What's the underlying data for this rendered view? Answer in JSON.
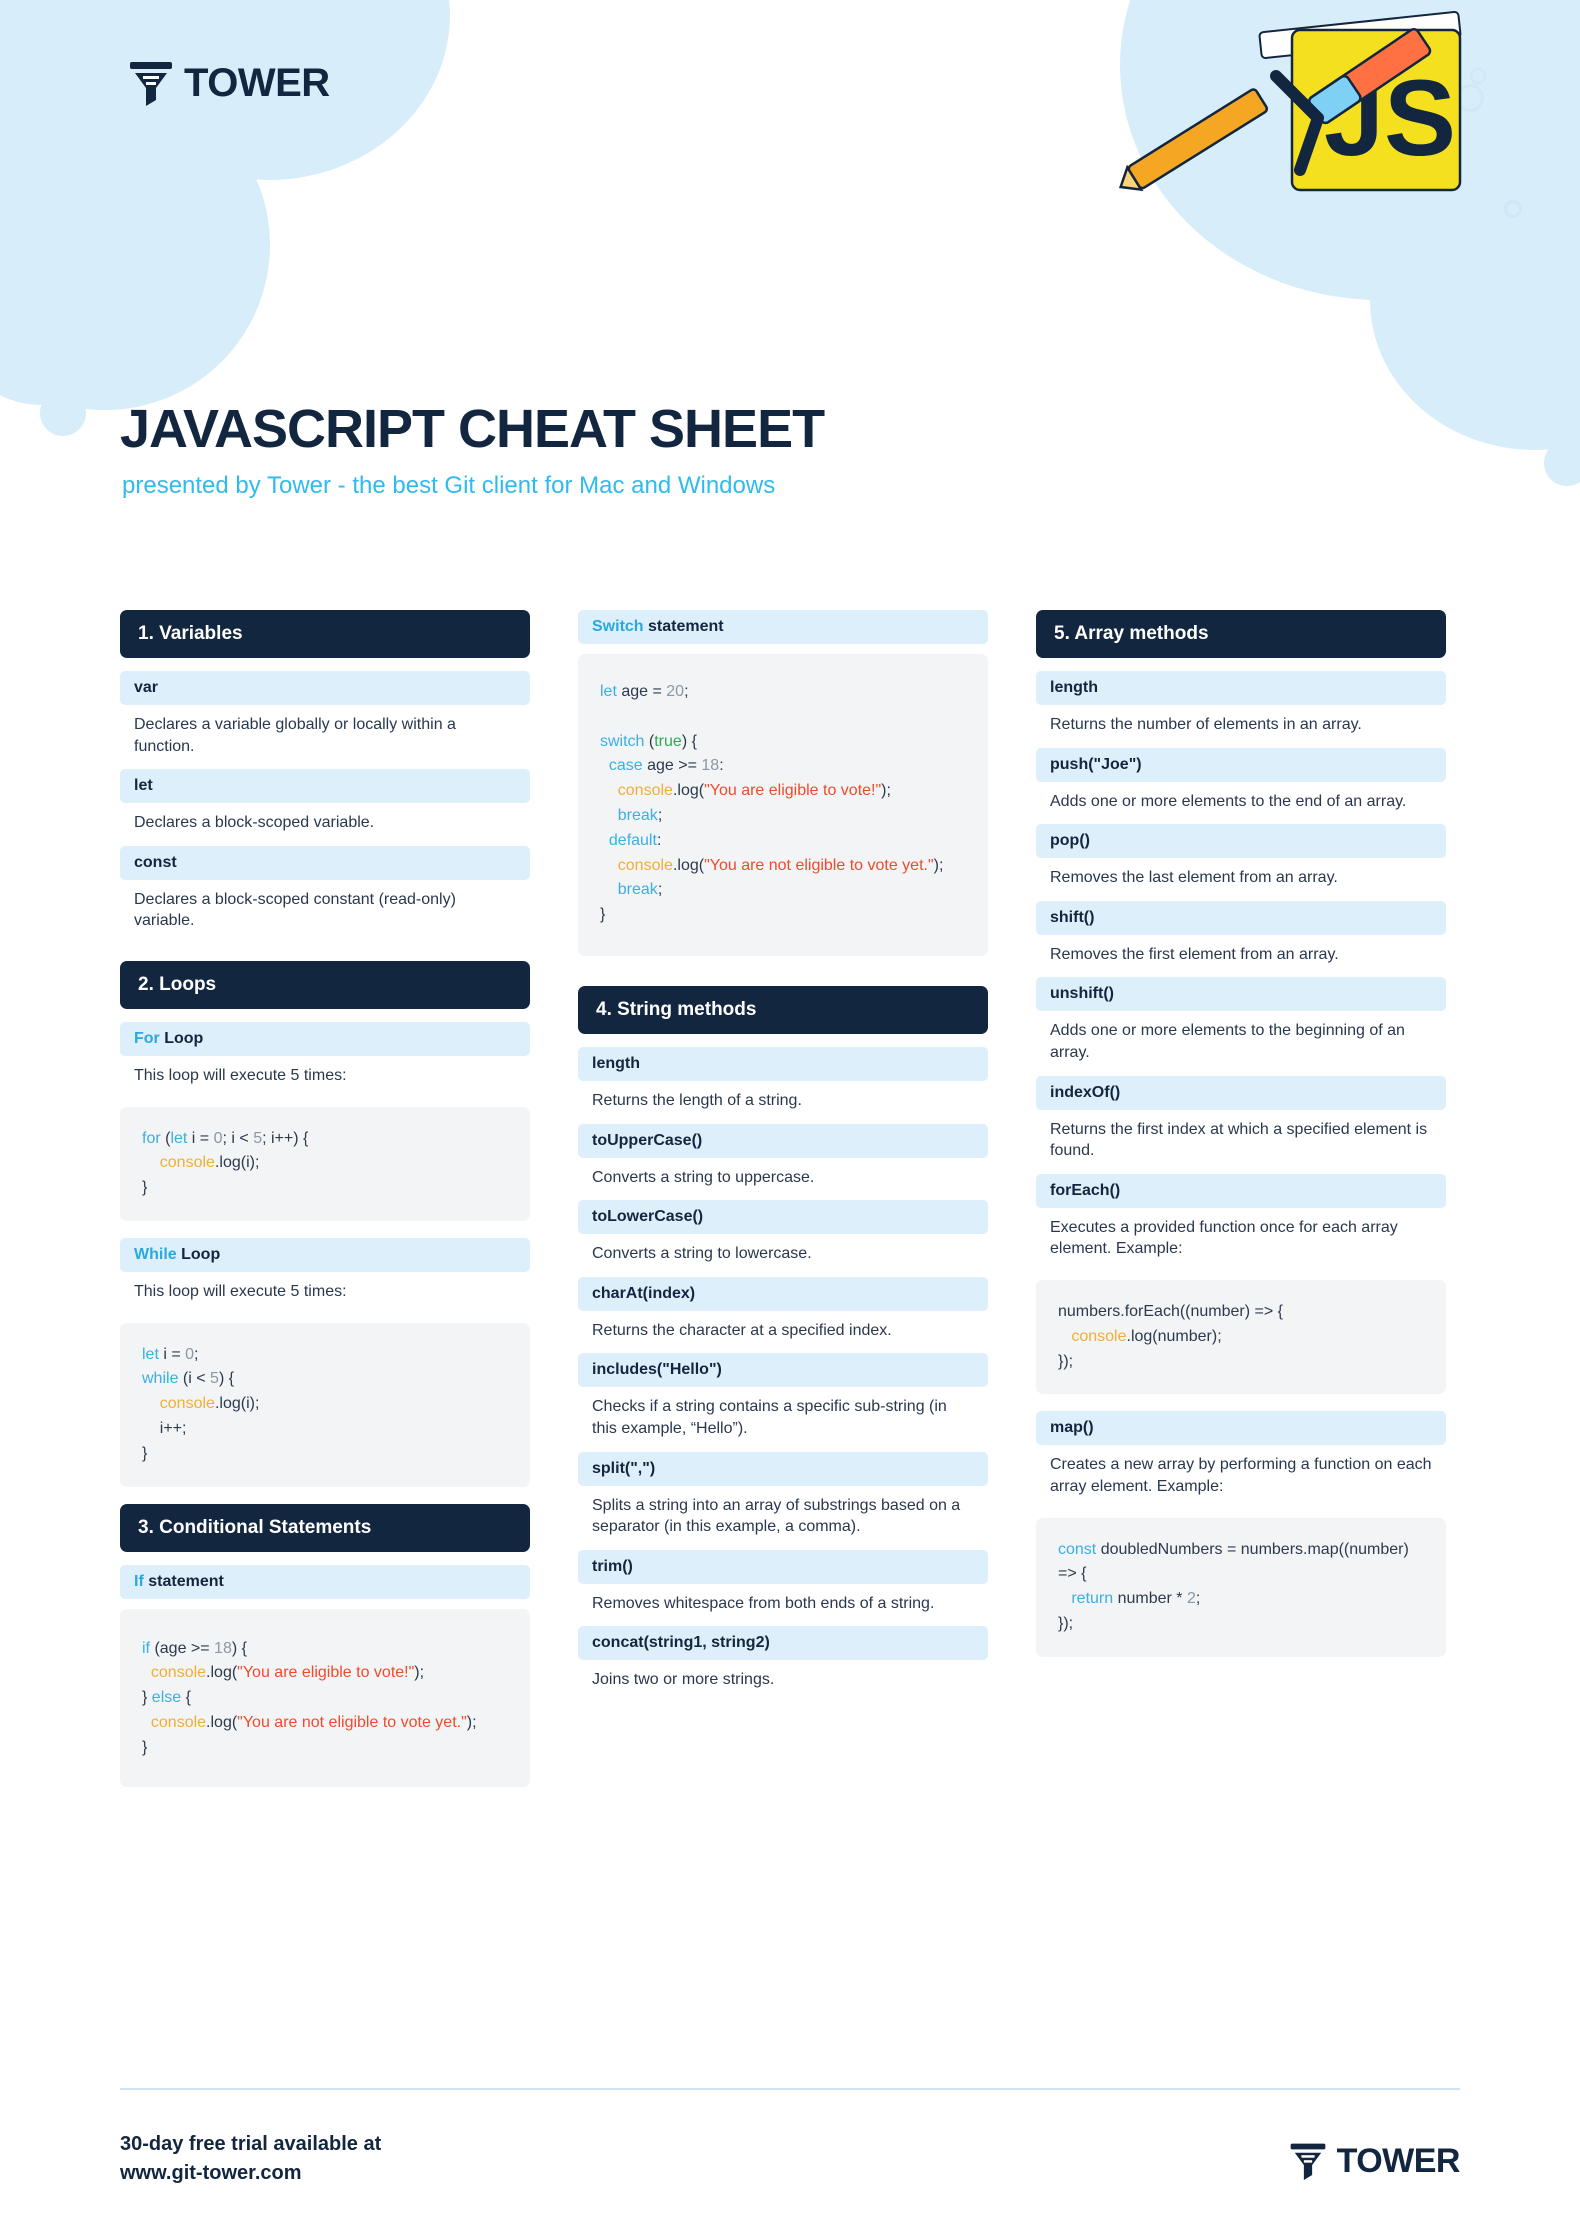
{
  "brand": {
    "name": "TOWER",
    "logo_icon": "tower-funnel-logo-icon"
  },
  "hero": {
    "title": "JAVASCRIPT CHEAT SHEET",
    "subtitle": "presented by Tower - the best Git client for Mac and Windows",
    "art_label": "JS",
    "art_icon": "javascript-sticker-illustration"
  },
  "colors": {
    "dark": "#13263f",
    "accent": "#2fbbee",
    "subhead_bg": "#ddeffa",
    "code_bg": "#f3f4f6",
    "keyword": "#3aafe3",
    "number": "#8a98a6",
    "function": "#f2ae34",
    "string": "#ef4b2b",
    "boolean": "#2faa54"
  },
  "columns": [
    {
      "sections": [
        {
          "heading": "1. Variables",
          "items": [
            {
              "term": "var",
              "desc": "Declares a variable globally or locally within a function."
            },
            {
              "term": "let",
              "desc": "Declares a block-scoped variable."
            },
            {
              "term": "const",
              "desc": "Declares a block-scoped constant (read-only) variable."
            }
          ]
        },
        {
          "heading": "2. Loops",
          "items": [
            {
              "term_kw": "For",
              "term_rest": "Loop",
              "desc": "This loop will execute 5 times:",
              "code_id": "for-loop"
            },
            {
              "term_kw": "While",
              "term_rest": "Loop",
              "desc": "This loop will execute 5 times:",
              "code_id": "while-loop"
            }
          ]
        },
        {
          "heading": "3. Conditional Statements",
          "items": [
            {
              "term_kw": "If",
              "term_rest": "statement",
              "code_id": "if-statement"
            }
          ]
        }
      ]
    },
    {
      "sections": [
        {
          "heading": null,
          "items": [
            {
              "term_kw": "Switch",
              "term_rest": "statement",
              "code_id": "switch-statement"
            }
          ]
        },
        {
          "heading": "4. String methods",
          "items": [
            {
              "term": "length",
              "desc": "Returns the length of a string."
            },
            {
              "term": "toUpperCase()",
              "desc": "Converts a string to uppercase."
            },
            {
              "term": "toLowerCase()",
              "desc": "Converts a string to lowercase."
            },
            {
              "term": "charAt(index)",
              "desc": "Returns the character at a specified index."
            },
            {
              "term": "includes(\"Hello\")",
              "desc": "Checks if a string contains a specific sub-string (in this example, “Hello”)."
            },
            {
              "term": "split(\",\")",
              "desc": "Splits a string into an array of substrings based on a separator (in this example, a comma)."
            },
            {
              "term": "trim()",
              "desc": "Removes whitespace from both ends of a string."
            },
            {
              "term": "concat(string1, string2)",
              "desc": "Joins two or more strings."
            }
          ]
        }
      ]
    },
    {
      "sections": [
        {
          "heading": "5. Array methods",
          "items": [
            {
              "term": "length",
              "desc": "Returns the number of elements in an array."
            },
            {
              "term": "push(\"Joe\")",
              "desc": "Adds one or more elements to the end of an array."
            },
            {
              "term": "pop()",
              "desc": "Removes the last element from an array."
            },
            {
              "term": "shift()",
              "desc": "Removes the first element from an array."
            },
            {
              "term": "unshift()",
              "desc": "Adds one or more elements to the beginning of an array."
            },
            {
              "term": "indexOf()",
              "desc": "Returns the first index at which a specified element is found."
            },
            {
              "term": "forEach()",
              "desc": "Executes a provided function once for each array element. Example:",
              "code_id": "foreach"
            },
            {
              "term": "map()",
              "desc": "Creates a new array by performing a function on each array element. Example:",
              "code_id": "map"
            }
          ]
        }
      ]
    }
  ],
  "code": {
    "for-loop": "for (let i = 0; i < 5; i++) {\n    console.log(i);\n}",
    "while-loop": "let i = 0;\nwhile (i < 5) {\n    console.log(i);\n    i++;\n}",
    "if-statement": "if (age >= 18) {\n  console.log(\"You are eligible to vote!\");\n} else {\n  console.log(\"You are not eligible to vote yet.\");\n}",
    "switch-statement": "let age = 20;\n\nswitch (true) {\n  case age >= 18:\n    console.log(\"You are eligible to vote!\");\n    break;\n  default:\n    console.log(\"You are not eligible to vote yet.\");\n    break;\n}",
    "foreach": "numbers.forEach((number) => {\n   console.log(number);\n});",
    "map": "const doubledNumbers = numbers.map((number) => {\n   return number * 2;\n});"
  },
  "footer": {
    "line1": "30-day free trial available at",
    "line2": "www.git-tower.com",
    "brand": "TOWER"
  }
}
